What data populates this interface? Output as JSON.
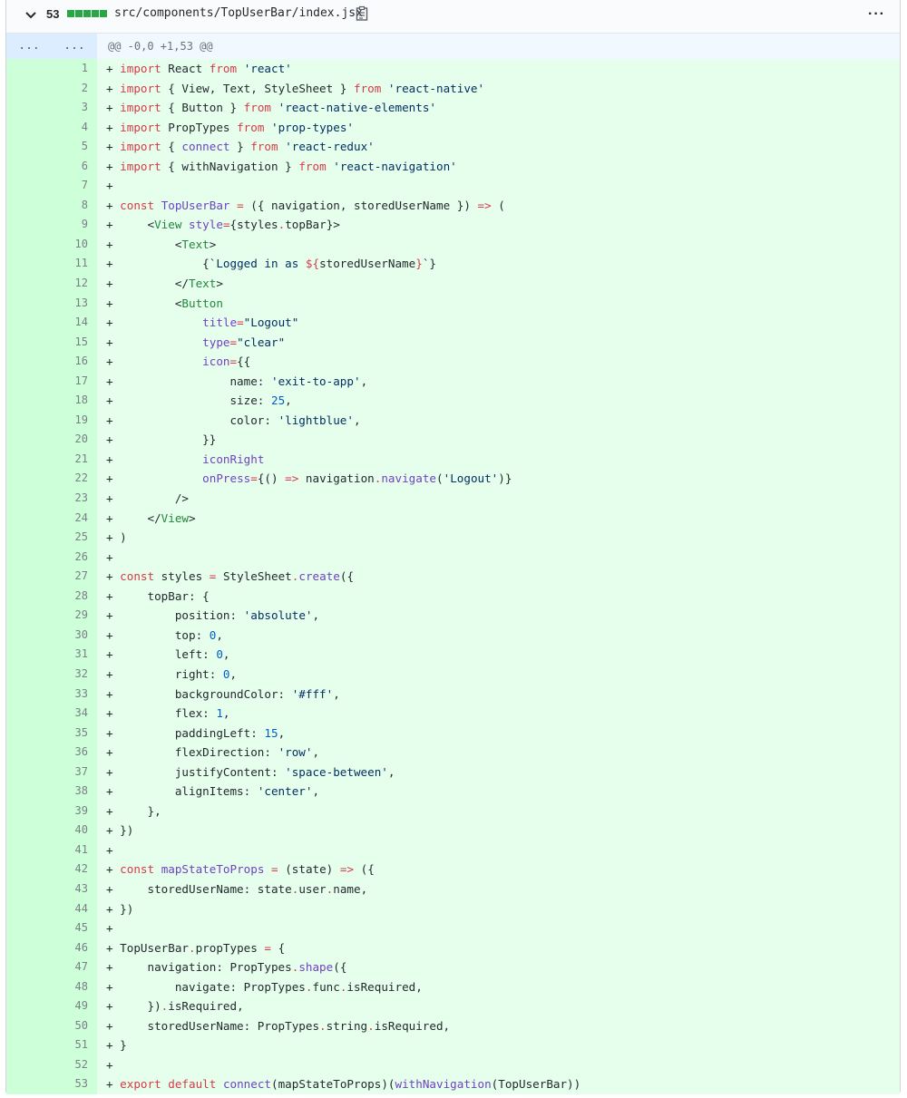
{
  "file": {
    "additions_count": "53",
    "diffstat_blocks": 5,
    "path": "src/components/TopUserBar/index.jsx",
    "menu_label": "···"
  },
  "hunk": {
    "expand_left": "...",
    "expand_right": "...",
    "header": "@@ -0,0 +1,53 @@"
  },
  "colors": {
    "addition_bg": "#e6ffed",
    "addition_gutter_bg": "#cdffd8",
    "hunk_bg": "#f1f8ff",
    "diffstat": "#28a745",
    "keyword": "#d73a49",
    "string": "#032f62",
    "function": "#6f42c1",
    "constant": "#005cc5",
    "tag": "#22863a"
  },
  "lines": [
    {
      "n": "1",
      "code": "+ import React from 'react'"
    },
    {
      "n": "2",
      "code": "+ import { View, Text, StyleSheet } from 'react-native'"
    },
    {
      "n": "3",
      "code": "+ import { Button } from 'react-native-elements'"
    },
    {
      "n": "4",
      "code": "+ import PropTypes from 'prop-types'"
    },
    {
      "n": "5",
      "code": "+ import { connect } from 'react-redux'"
    },
    {
      "n": "6",
      "code": "+ import { withNavigation } from 'react-navigation'"
    },
    {
      "n": "7",
      "code": "+"
    },
    {
      "n": "8",
      "code": "+ const TopUserBar = ({ navigation, storedUserName }) => ("
    },
    {
      "n": "9",
      "code": "+     <View style={styles.topBar}>"
    },
    {
      "n": "10",
      "code": "+         <Text>"
    },
    {
      "n": "11",
      "code": "+             {`Logged in as ${storedUserName}`}"
    },
    {
      "n": "12",
      "code": "+         </Text>"
    },
    {
      "n": "13",
      "code": "+         <Button"
    },
    {
      "n": "14",
      "code": "+             title=\"Logout\""
    },
    {
      "n": "15",
      "code": "+             type=\"clear\""
    },
    {
      "n": "16",
      "code": "+             icon={{"
    },
    {
      "n": "17",
      "code": "+                 name: 'exit-to-app',"
    },
    {
      "n": "18",
      "code": "+                 size: 25,"
    },
    {
      "n": "19",
      "code": "+                 color: 'lightblue',"
    },
    {
      "n": "20",
      "code": "+             }}"
    },
    {
      "n": "21",
      "code": "+             iconRight"
    },
    {
      "n": "22",
      "code": "+             onPress={() => navigation.navigate('Logout')}"
    },
    {
      "n": "23",
      "code": "+         />"
    },
    {
      "n": "24",
      "code": "+     </View>"
    },
    {
      "n": "25",
      "code": "+ )"
    },
    {
      "n": "26",
      "code": "+"
    },
    {
      "n": "27",
      "code": "+ const styles = StyleSheet.create({"
    },
    {
      "n": "28",
      "code": "+     topBar: {"
    },
    {
      "n": "29",
      "code": "+         position: 'absolute',"
    },
    {
      "n": "30",
      "code": "+         top: 0,"
    },
    {
      "n": "31",
      "code": "+         left: 0,"
    },
    {
      "n": "32",
      "code": "+         right: 0,"
    },
    {
      "n": "33",
      "code": "+         backgroundColor: '#fff',"
    },
    {
      "n": "34",
      "code": "+         flex: 1,"
    },
    {
      "n": "35",
      "code": "+         paddingLeft: 15,"
    },
    {
      "n": "36",
      "code": "+         flexDirection: 'row',"
    },
    {
      "n": "37",
      "code": "+         justifyContent: 'space-between',"
    },
    {
      "n": "38",
      "code": "+         alignItems: 'center',"
    },
    {
      "n": "39",
      "code": "+     },"
    },
    {
      "n": "40",
      "code": "+ })"
    },
    {
      "n": "41",
      "code": "+"
    },
    {
      "n": "42",
      "code": "+ const mapStateToProps = (state) => ({"
    },
    {
      "n": "43",
      "code": "+     storedUserName: state.user.name,"
    },
    {
      "n": "44",
      "code": "+ })"
    },
    {
      "n": "45",
      "code": "+"
    },
    {
      "n": "46",
      "code": "+ TopUserBar.propTypes = {"
    },
    {
      "n": "47",
      "code": "+     navigation: PropTypes.shape({"
    },
    {
      "n": "48",
      "code": "+         navigate: PropTypes.func.isRequired,"
    },
    {
      "n": "49",
      "code": "+     }).isRequired,"
    },
    {
      "n": "50",
      "code": "+     storedUserName: PropTypes.string.isRequired,"
    },
    {
      "n": "51",
      "code": "+ }"
    },
    {
      "n": "52",
      "code": "+"
    },
    {
      "n": "53",
      "code": "+ export default connect(mapStateToProps)(withNavigation(TopUserBar))"
    }
  ]
}
